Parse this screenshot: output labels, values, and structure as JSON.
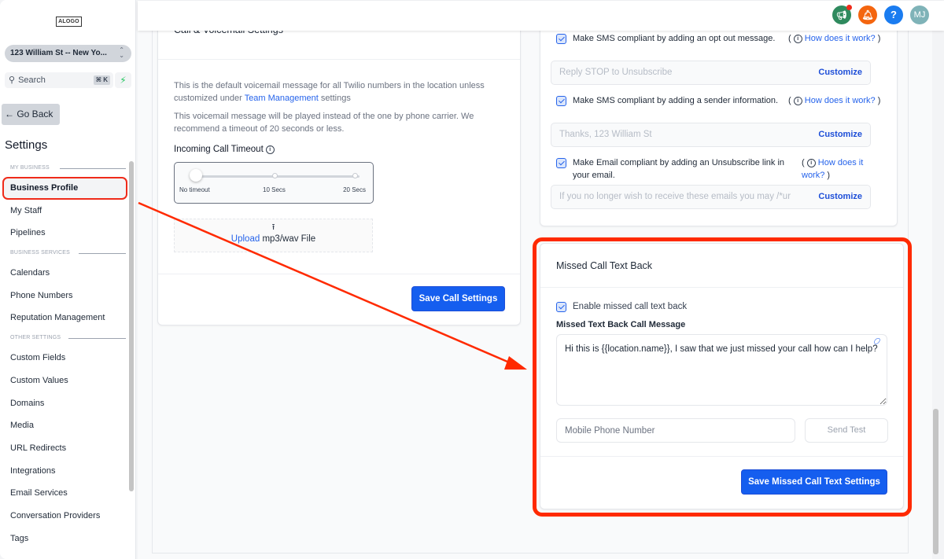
{
  "sidebar": {
    "logo_text": "ALOGO",
    "location": "123 William St -- New Yo...",
    "search_placeholder": "Search",
    "search_shortcut": "⌘ K",
    "go_back_label": "Go Back",
    "title": "Settings",
    "sections": [
      {
        "heading": "MY BUSINESS",
        "items": [
          {
            "label": "Business Profile",
            "active": true
          },
          {
            "label": "My Staff"
          },
          {
            "label": "Pipelines"
          }
        ]
      },
      {
        "heading": "BUSINESS SERVICES",
        "items": [
          {
            "label": "Calendars"
          },
          {
            "label": "Phone Numbers"
          },
          {
            "label": "Reputation Management"
          }
        ]
      },
      {
        "heading": "OTHER SETTINGS",
        "items": [
          {
            "label": "Custom Fields"
          },
          {
            "label": "Custom Values"
          },
          {
            "label": "Domains"
          },
          {
            "label": "Media"
          },
          {
            "label": "URL Redirects"
          },
          {
            "label": "Integrations"
          },
          {
            "label": "Email Services"
          },
          {
            "label": "Conversation Providers"
          },
          {
            "label": "Tags"
          }
        ]
      }
    ]
  },
  "topbar": {
    "icons": [
      {
        "name": "announcement-icon",
        "glyph": "📢",
        "color": "#2f8a5e",
        "badge": true
      },
      {
        "name": "notification-bell-icon",
        "glyph": "🔔",
        "color": "#f4650f"
      },
      {
        "name": "help-icon",
        "glyph": "?",
        "color": "#1a7cf0"
      },
      {
        "name": "user-avatar",
        "glyph": "MJ",
        "color": "#7fb3b8"
      }
    ]
  },
  "call_voicemail": {
    "title": "Call & Voicemail Settings",
    "desc1_pre": "This is the default voicemail message for all Twilio numbers in the location unless customized under ",
    "desc1_link": "Team Management",
    "desc1_post": " settings",
    "desc2": "This voicemail message will be played instead of the one by phone carrier. We recommend a timeout of 20 seconds or less.",
    "timeout_label": "Incoming Call Timeout",
    "slider": {
      "labels": [
        "No timeout",
        "10 Secs",
        "20 Secs"
      ],
      "value_seconds": 0,
      "max_seconds": 20
    },
    "upload_link": "Upload",
    "upload_text": " mp3/wav File",
    "save_label": "Save Call Settings"
  },
  "compliance": {
    "items": [
      {
        "checked": true,
        "text": "Make SMS compliant by adding an opt out message.",
        "help_link": "How does it work?",
        "input_value": "Reply STOP to Unsubscribe",
        "customize_label": "Customize"
      },
      {
        "checked": true,
        "text": "Make SMS compliant by adding a sender information.",
        "help_link": "How does it work?",
        "input_value": "Thanks, 123 William St",
        "customize_label": "Customize"
      },
      {
        "checked": true,
        "text": "Make Email compliant by adding an Unsubscribe link in your email.",
        "help_link": "How does it work?",
        "input_value": "If you no longer wish to receive these emails you may /*ur",
        "customize_label": "Customize"
      }
    ]
  },
  "missed_call": {
    "title": "Missed Call Text Back",
    "enable_label": "Enable missed call text back",
    "enabled": true,
    "message_label": "Missed Text Back Call Message",
    "message_value": "Hi this is {{location.name}}, I saw that we just missed your call how can I help?",
    "phone_placeholder": "Mobile Phone Number",
    "send_test_label": "Send Test",
    "save_label": "Save Missed Call Text Settings"
  },
  "annotation": {
    "highlight_color": "#ff2a00"
  }
}
